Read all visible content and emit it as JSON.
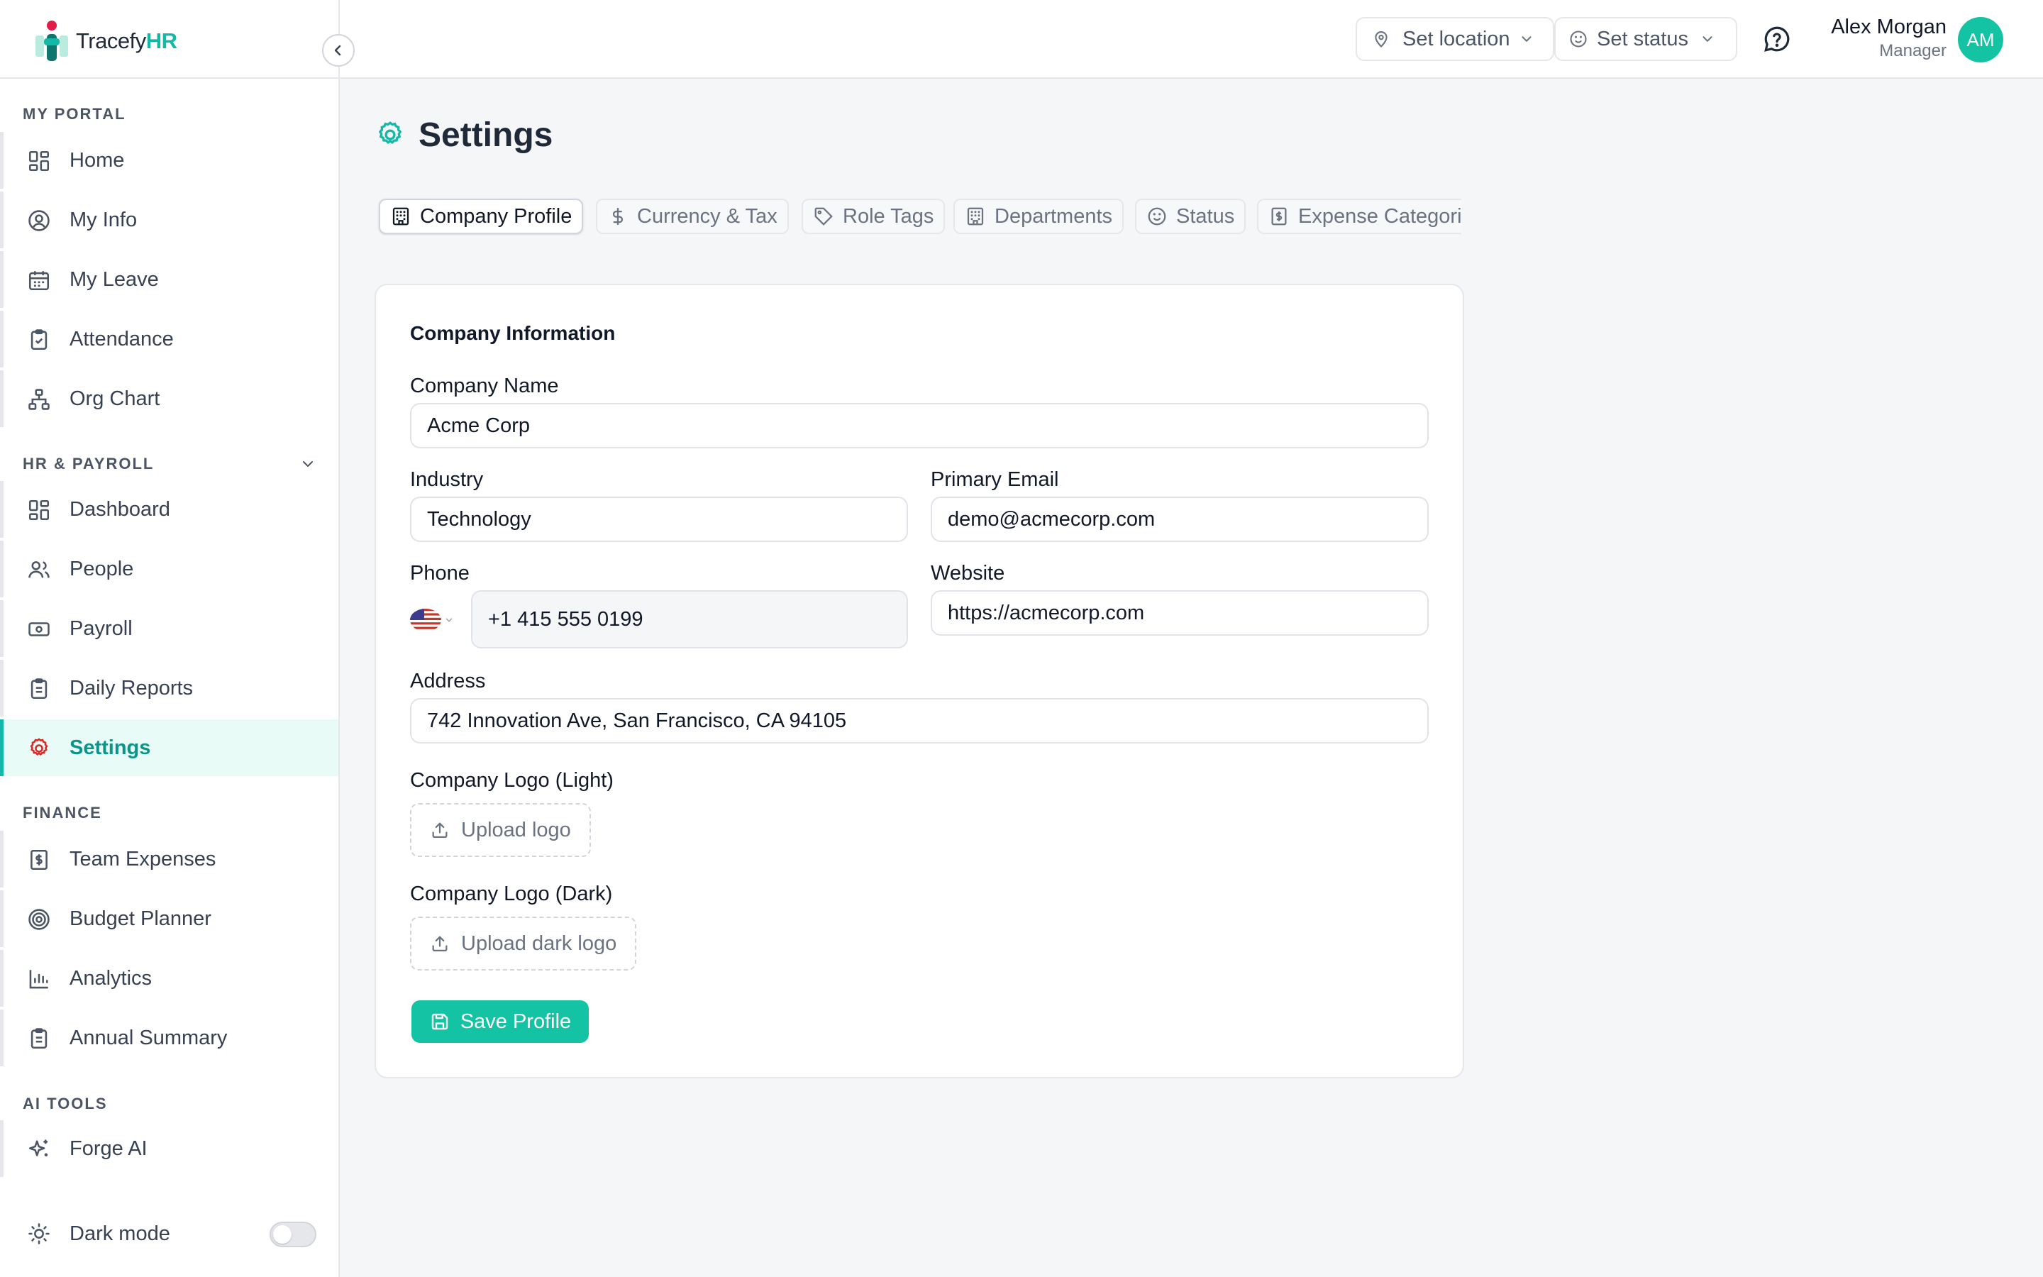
{
  "brand": {
    "name_prefix": "Tracefy",
    "name_suffix": "HR"
  },
  "sidebar": {
    "sections": [
      {
        "label": "MY PORTAL"
      },
      {
        "label": "HR & PAYROLL"
      },
      {
        "label": "FINANCE"
      },
      {
        "label": "AI TOOLS"
      }
    ],
    "items": [
      {
        "label": "Home",
        "icon": "grid-icon"
      },
      {
        "label": "My Info",
        "icon": "user-circle-icon"
      },
      {
        "label": "My Leave",
        "icon": "calendar-icon"
      },
      {
        "label": "Attendance",
        "icon": "clipboard-check-icon"
      },
      {
        "label": "Org Chart",
        "icon": "org-chart-icon"
      },
      {
        "label": "Dashboard",
        "icon": "grid-icon"
      },
      {
        "label": "People",
        "icon": "users-icon"
      },
      {
        "label": "Payroll",
        "icon": "banknote-icon"
      },
      {
        "label": "Daily Reports",
        "icon": "clipboard-icon"
      },
      {
        "label": "Settings",
        "icon": "gear-icon",
        "active": true
      },
      {
        "label": "Team Expenses",
        "icon": "receipt-icon"
      },
      {
        "label": "Budget Planner",
        "icon": "target-icon"
      },
      {
        "label": "Analytics",
        "icon": "bar-chart-icon"
      },
      {
        "label": "Annual Summary",
        "icon": "clipboard-icon"
      },
      {
        "label": "Forge AI",
        "icon": "sparkles-icon"
      }
    ],
    "dark_mode_label": "Dark mode",
    "dark_mode_on": false
  },
  "topbar": {
    "location_label": "Set location",
    "status_label": "Set status",
    "user_name": "Alex Morgan",
    "user_role": "Manager",
    "avatar_initials": "AM"
  },
  "page": {
    "title": "Settings"
  },
  "tabs": [
    {
      "label": "Company Profile",
      "icon": "building-icon",
      "active": true
    },
    {
      "label": "Currency & Tax",
      "icon": "dollar-icon"
    },
    {
      "label": "Role Tags",
      "icon": "tag-icon"
    },
    {
      "label": "Departments",
      "icon": "building-icon"
    },
    {
      "label": "Status",
      "icon": "smile-icon"
    },
    {
      "label": "Expense Categories",
      "icon": "receipt-icon"
    }
  ],
  "form": {
    "heading": "Company Information",
    "company_name": {
      "label": "Company Name",
      "value": "Acme Corp"
    },
    "industry": {
      "label": "Industry",
      "value": "Technology"
    },
    "primary_email": {
      "label": "Primary Email",
      "value": "demo@acmecorp.com"
    },
    "phone": {
      "label": "Phone",
      "value": "+1 415 555 0199",
      "country_flag": "us-flag-icon"
    },
    "website": {
      "label": "Website",
      "value": "https://acmecorp.com"
    },
    "address": {
      "label": "Address",
      "value": "742 Innovation Ave, San Francisco, CA 94105"
    },
    "logo_light": {
      "label": "Company Logo (Light)",
      "button": "Upload logo"
    },
    "logo_dark": {
      "label": "Company Logo (Dark)",
      "button": "Upload dark logo"
    },
    "save_label": "Save Profile"
  },
  "colors": {
    "accent": "#14c2a4",
    "accent_text": "#0d9488",
    "active_bg": "#e9fbf7",
    "settings_icon": "#dc2626"
  }
}
